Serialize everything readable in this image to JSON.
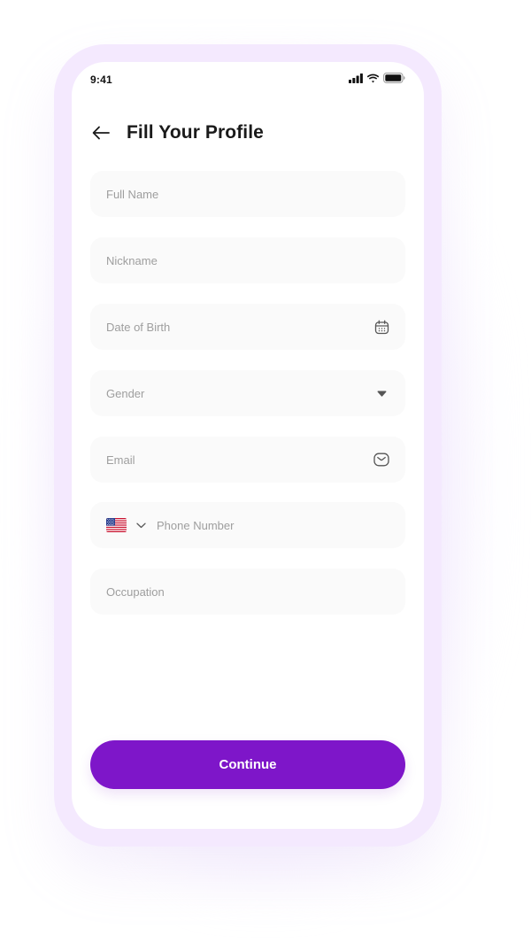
{
  "status_bar": {
    "time": "9:41"
  },
  "header": {
    "title": "Fill Your Profile",
    "back_icon": "arrow-left-icon"
  },
  "form": {
    "full_name": {
      "placeholder": "Full Name",
      "value": ""
    },
    "nickname": {
      "placeholder": "Nickname",
      "value": ""
    },
    "date_of_birth": {
      "placeholder": "Date of Birth",
      "value": "",
      "icon": "calendar-icon"
    },
    "gender": {
      "placeholder": "Gender",
      "value": "",
      "icon": "caret-down-icon"
    },
    "email": {
      "placeholder": "Email",
      "value": "",
      "icon": "mail-icon"
    },
    "phone": {
      "placeholder": "Phone Number",
      "value": "",
      "country_flag": "us-flag-icon",
      "chevron": "chevron-down-icon"
    },
    "occupation": {
      "placeholder": "Occupation",
      "value": ""
    }
  },
  "actions": {
    "continue_label": "Continue"
  },
  "colors": {
    "accent": "#7e16c9",
    "frame": "#f4e9fe",
    "field_bg": "#fafafa",
    "placeholder": "#9e9e9e"
  }
}
